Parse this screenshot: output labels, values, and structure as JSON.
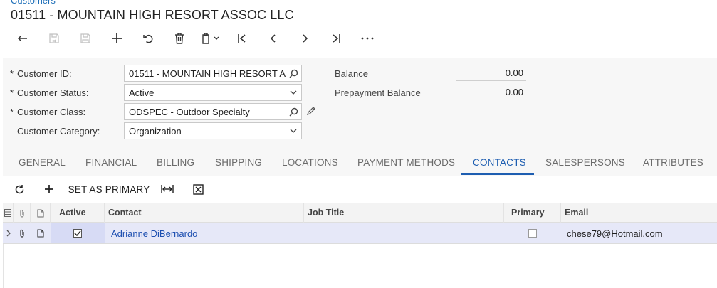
{
  "breadcrumb": "Customers",
  "title": "01511 - MOUNTAIN HIGH RESORT ASSOC LLC",
  "toolbar": {
    "icons": [
      "undo-back-icon",
      "save-close-icon",
      "save-icon",
      "add-icon",
      "cancel-revert-icon",
      "delete-icon",
      "copy-paste-icon",
      "first-record-icon",
      "previous-record-icon",
      "next-record-icon",
      "last-record-icon",
      "more-icon"
    ]
  },
  "form": {
    "customer_id": {
      "label": "Customer ID:",
      "value": "01511 - MOUNTAIN HIGH RESORT A",
      "required": "*"
    },
    "customer_status": {
      "label": "Customer Status:",
      "value": "Active",
      "required": "*"
    },
    "customer_class": {
      "label": "Customer Class:",
      "value": "ODSPEC - Outdoor Specialty",
      "required": "*"
    },
    "customer_category": {
      "label": "Customer Category:",
      "value": "Organization"
    },
    "balance": {
      "label": "Balance",
      "value": "0.00"
    },
    "prepayment_balance": {
      "label": "Prepayment Balance",
      "value": "0.00"
    }
  },
  "tabs": [
    {
      "label": "GENERAL"
    },
    {
      "label": "FINANCIAL"
    },
    {
      "label": "BILLING"
    },
    {
      "label": "SHIPPING"
    },
    {
      "label": "LOCATIONS"
    },
    {
      "label": "PAYMENT METHODS"
    },
    {
      "label": "CONTACTS"
    },
    {
      "label": "SALESPERSONS"
    },
    {
      "label": "ATTRIBUTES"
    }
  ],
  "active_tab": "CONTACTS",
  "grid_toolbar": {
    "set_primary_label": "SET AS PRIMARY"
  },
  "grid": {
    "columns": [
      "Active",
      "Contact",
      "Job Title",
      "Primary",
      "Email"
    ],
    "rows": [
      {
        "active": true,
        "contact": "Adrianne DiBernardo",
        "job_title": "",
        "primary": false,
        "email": "chese79@Hotmail.com"
      }
    ]
  },
  "colors": {
    "accent": "#1e5eb1",
    "link": "#1d4fb0",
    "selected_row": "#e6e8f8"
  }
}
